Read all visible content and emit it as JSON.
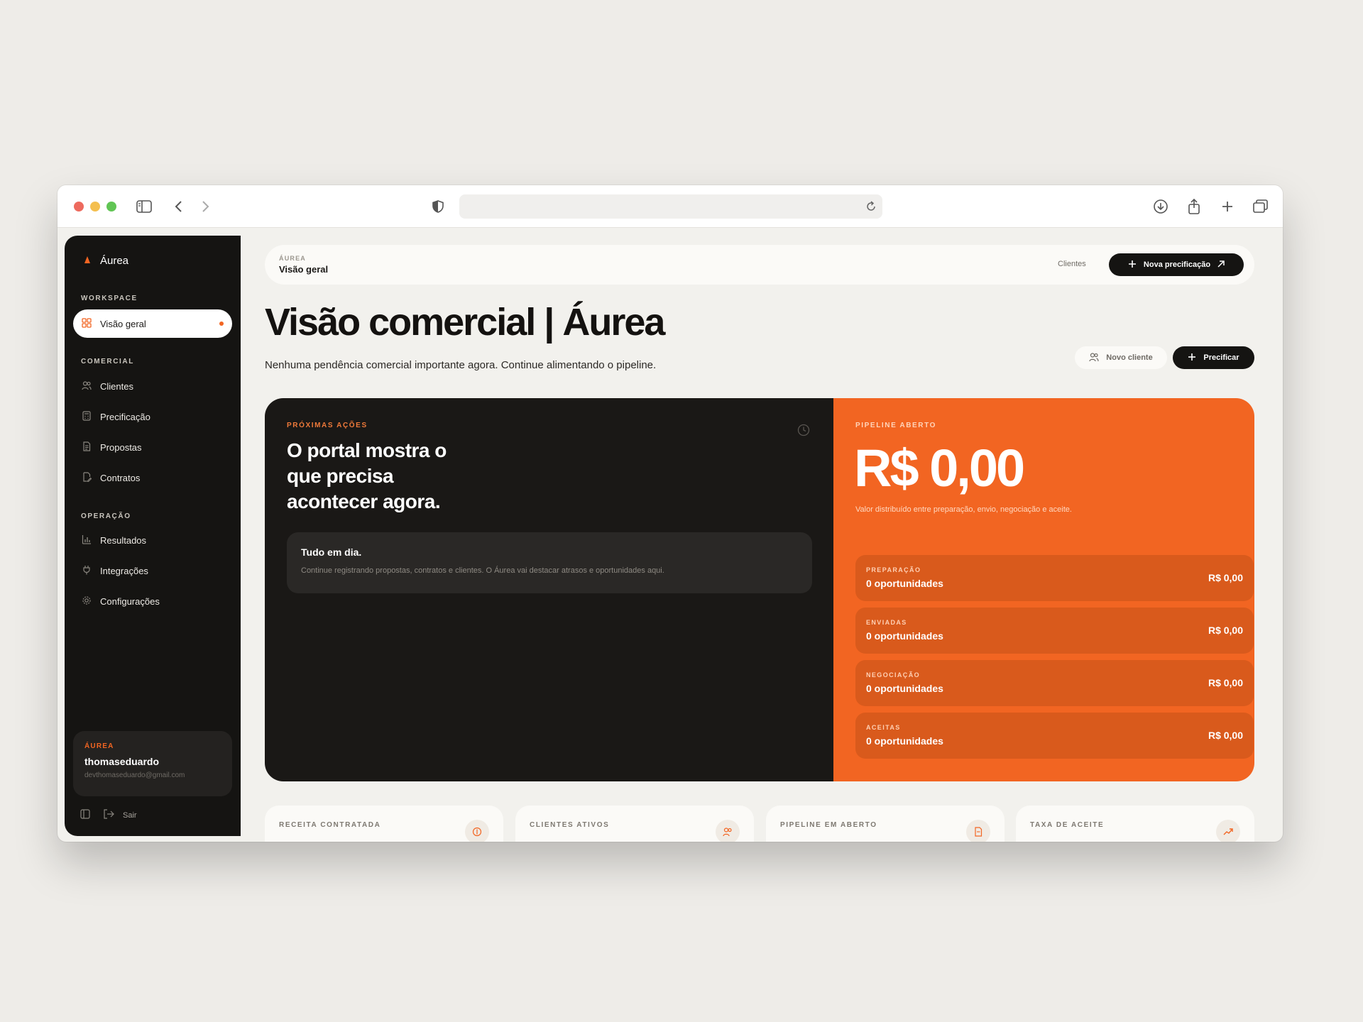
{
  "sidebar": {
    "brand": "Áurea",
    "sections": {
      "workspace": "WORKSPACE",
      "comercial": "COMERCIAL",
      "operacao": "OPERAÇÃO"
    },
    "items": [
      {
        "label": "Visão geral",
        "icon": "grid-icon",
        "active": true
      },
      {
        "label": "Clientes",
        "icon": "users-icon"
      },
      {
        "label": "Precificação",
        "icon": "calculator-icon"
      },
      {
        "label": "Propostas",
        "icon": "document-icon"
      },
      {
        "label": "Contratos",
        "icon": "contract-icon"
      },
      {
        "label": "Resultados",
        "icon": "bar-chart-icon"
      },
      {
        "label": "Integrações",
        "icon": "plug-icon"
      },
      {
        "label": "Configurações",
        "icon": "gear-icon"
      }
    ],
    "user": {
      "brand": "ÁUREA",
      "name": "thomaseduardo",
      "email": "devthomaseduardo@gmail.com"
    },
    "logout_label": "Sair"
  },
  "topbar": {
    "crumb_small": "ÁUREA",
    "crumb_main": "Visão geral",
    "clients_link": "Clientes",
    "new_pricing_button": "Nova precificação"
  },
  "header": {
    "title": "Visão comercial | Áurea",
    "subtitle": "Nenhuma pendência comercial importante agora. Continue alimentando o pipeline.",
    "new_client_button": "Novo cliente",
    "price_button": "Precificar"
  },
  "next_actions": {
    "eyebrow": "PRÓXIMAS AÇÕES",
    "heading": "O portal mostra o que precisa acontecer agora.",
    "card_title": "Tudo em dia.",
    "card_text": "Continue registrando propostas, contratos e clientes. O Áurea vai destacar atrasos e oportunidades aqui."
  },
  "pipeline": {
    "eyebrow": "PIPELINE ABERTO",
    "amount": "R$ 0,00",
    "description": "Valor distribuído entre preparação, envio, negociação e aceite.",
    "stages": [
      {
        "label": "PREPARAÇÃO",
        "count": "0 oportunidades",
        "value": "R$ 0,00"
      },
      {
        "label": "ENVIADAS",
        "count": "0 oportunidades",
        "value": "R$ 0,00"
      },
      {
        "label": "NEGOCIAÇÃO",
        "count": "0 oportunidades",
        "value": "R$ 0,00"
      },
      {
        "label": "ACEITAS",
        "count": "0 oportunidades",
        "value": "R$ 0,00"
      }
    ]
  },
  "stats": [
    {
      "label": "RECEITA CONTRATADA",
      "icon": "dollar-icon"
    },
    {
      "label": "CLIENTES ATIVOS",
      "icon": "users-icon"
    },
    {
      "label": "PIPELINE EM ABERTO",
      "icon": "file-icon"
    },
    {
      "label": "TAXA DE ACEITE",
      "icon": "trend-up-icon"
    }
  ],
  "colors": {
    "accent": "#f26522",
    "dark": "#151412",
    "background": "#eeece8"
  }
}
